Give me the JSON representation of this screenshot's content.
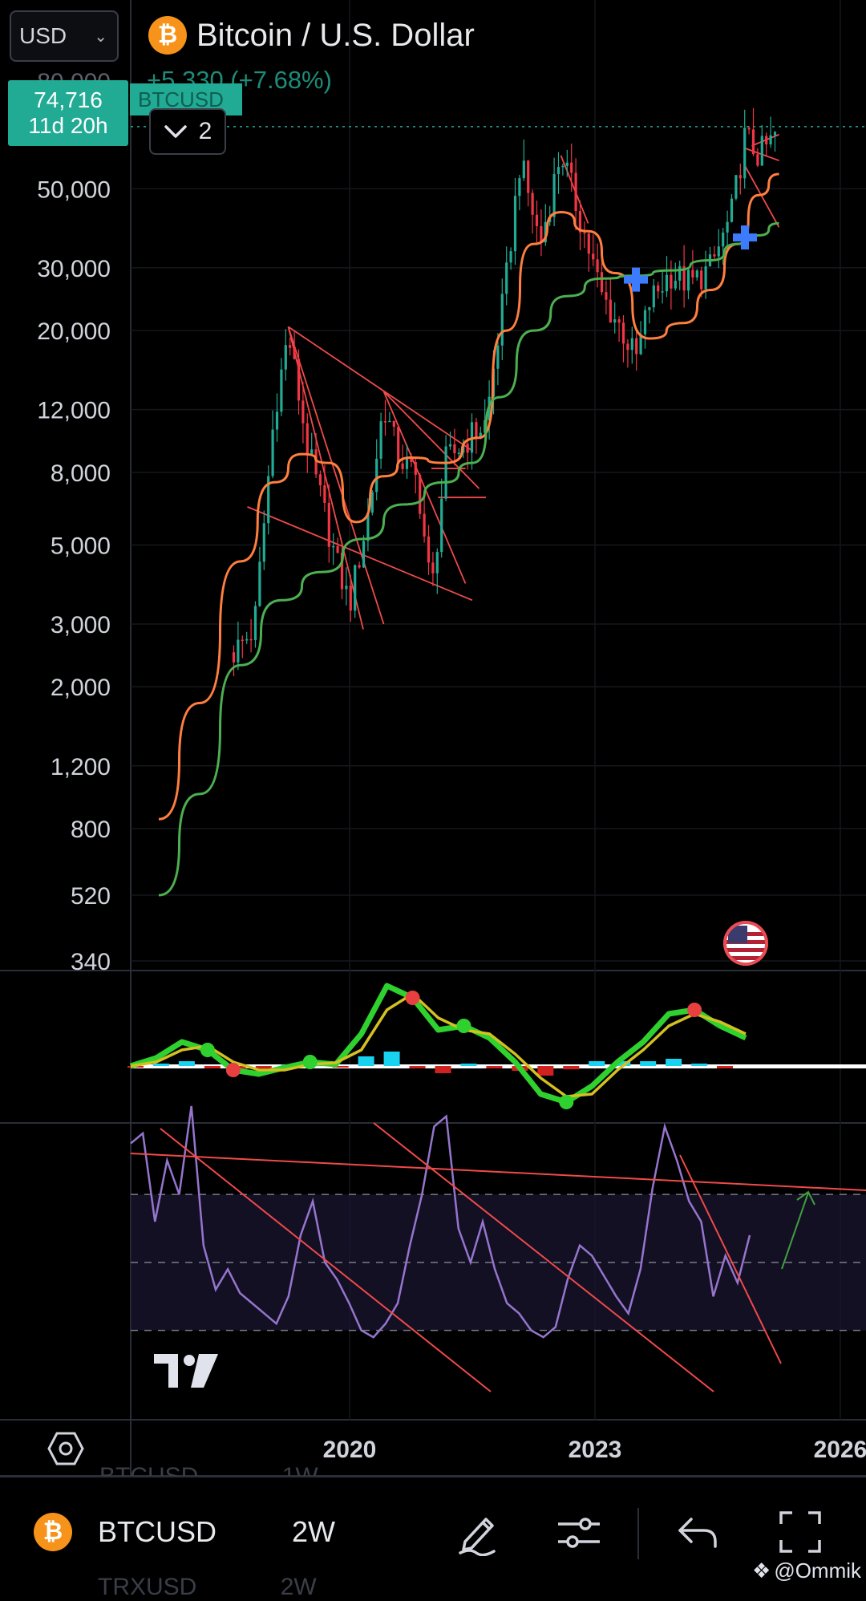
{
  "header": {
    "currency": "USD",
    "title": "Bitcoin / U.S. Dollar",
    "change": "+5,330 (+7.68%)",
    "price": "74,716",
    "countdown": "11d 20h",
    "symbol_tag": "BTCUSD",
    "collapsed_count": "2",
    "partial_top_label": "80,000"
  },
  "bottom_bar": {
    "symbol": "BTCUSD",
    "interval": "2W",
    "ghost_above_symbol": "BTCUSD",
    "ghost_above_interval": "1W",
    "ghost_below_symbol": "TRXUSD",
    "ghost_below_interval": "2W",
    "watermark": "@Ommik"
  },
  "icons": {
    "coin": "bitcoin-icon",
    "draw": "pen-icon",
    "indicators": "sliders-icon",
    "undo": "undo-icon",
    "fullscreen": "fullscreen-icon",
    "settings": "hexagon-settings-icon",
    "event": "us-flag-icon",
    "logo": "tradingview-logo-icon"
  },
  "colors": {
    "up": "#22ab94",
    "down": "#f23645",
    "ma_fast": "#ff7f3f",
    "ma_slow": "#4caf50",
    "trendline": "#f04a4a",
    "rsi": "#9575cd",
    "background": "#000000"
  },
  "chart_data": [
    {
      "type": "candlestick",
      "title": "Bitcoin / U.S. Dollar",
      "scale": "log",
      "y_ticks": [
        340,
        520,
        800,
        1200,
        2000,
        3000,
        5000,
        8000,
        12000,
        20000,
        30000,
        50000
      ],
      "x_ticks": [
        "2020",
        "2023",
        "2026"
      ],
      "last_price": 74716,
      "anchors": [
        {
          "date": "2018-08",
          "price": 2500
        },
        {
          "date": "2018-11",
          "price": 2900
        },
        {
          "date": "2019-02",
          "price": 12000
        },
        {
          "date": "2019-04",
          "price": 19500
        },
        {
          "date": "2019-07",
          "price": 9000
        },
        {
          "date": "2019-09",
          "price": 6500
        },
        {
          "date": "2019-11",
          "price": 4500
        },
        {
          "date": "2020-01",
          "price": 3400
        },
        {
          "date": "2020-04",
          "price": 6500
        },
        {
          "date": "2020-06",
          "price": 12500
        },
        {
          "date": "2020-08",
          "price": 9000
        },
        {
          "date": "2020-11",
          "price": 7500
        },
        {
          "date": "2021-01",
          "price": 3600
        },
        {
          "date": "2021-03",
          "price": 8500
        },
        {
          "date": "2021-06",
          "price": 9800
        },
        {
          "date": "2021-09",
          "price": 11000
        },
        {
          "date": "2021-12",
          "price": 28000
        },
        {
          "date": "2022-02",
          "price": 60000
        },
        {
          "date": "2022-05",
          "price": 35000
        },
        {
          "date": "2022-08",
          "price": 64000
        },
        {
          "date": "2022-11",
          "price": 40000
        },
        {
          "date": "2023-02",
          "price": 25000
        },
        {
          "date": "2023-05",
          "price": 20000
        },
        {
          "date": "2023-07",
          "price": 16500
        },
        {
          "date": "2023-09",
          "price": 24000
        },
        {
          "date": "2023-12",
          "price": 29000
        },
        {
          "date": "2024-03",
          "price": 27000
        },
        {
          "date": "2024-06",
          "price": 30000
        },
        {
          "date": "2024-09",
          "price": 42000
        },
        {
          "date": "2024-11",
          "price": 70000
        },
        {
          "date": "2025-01",
          "price": 62000
        },
        {
          "date": "2025-03",
          "price": 68000
        },
        {
          "date": "2025-04",
          "price": 74716
        }
      ],
      "moving_averages": [
        {
          "color": "#ff7f3f",
          "points": [
            [
              "2017-09",
              850
            ],
            [
              "2018-03",
              1800
            ],
            [
              "2018-09",
              4500
            ],
            [
              "2019-02",
              7500
            ],
            [
              "2019-06",
              9000
            ],
            [
              "2019-10",
              8500
            ],
            [
              "2020-02",
              5800
            ],
            [
              "2020-06",
              7800
            ],
            [
              "2020-10",
              8800
            ],
            [
              "2021-03",
              8500
            ],
            [
              "2021-08",
              10000
            ],
            [
              "2021-12",
              20000
            ],
            [
              "2022-04",
              35000
            ],
            [
              "2022-08",
              43000
            ],
            [
              "2022-12",
              38000
            ],
            [
              "2023-04",
              29000
            ],
            [
              "2023-09",
              19000
            ],
            [
              "2024-02",
              21000
            ],
            [
              "2024-06",
              26000
            ],
            [
              "2024-10",
              35000
            ],
            [
              "2025-01",
              48000
            ],
            [
              "2025-04",
              55000
            ]
          ]
        },
        {
          "color": "#4caf50",
          "points": [
            [
              "2017-09",
              520
            ],
            [
              "2018-03",
              1000
            ],
            [
              "2018-09",
              2300
            ],
            [
              "2019-03",
              3500
            ],
            [
              "2019-09",
              4200
            ],
            [
              "2020-03",
              5200
            ],
            [
              "2020-09",
              6500
            ],
            [
              "2021-03",
              7500
            ],
            [
              "2021-07",
              8500
            ],
            [
              "2021-11",
              13000
            ],
            [
              "2022-04",
              20000
            ],
            [
              "2022-09",
              25000
            ],
            [
              "2023-02",
              28000
            ],
            [
              "2023-07",
              28500
            ],
            [
              "2023-12",
              29500
            ],
            [
              "2024-06",
              31500
            ],
            [
              "2024-10",
              35000
            ],
            [
              "2025-01",
              37000
            ],
            [
              "2025-04",
              40000
            ]
          ]
        }
      ],
      "markers": [
        {
          "date": "2023-07",
          "price": 27800,
          "label": "+"
        },
        {
          "date": "2024-11",
          "price": 36500,
          "label": "+"
        }
      ],
      "event": {
        "date": "2025-04",
        "label": "us-flag"
      }
    },
    {
      "type": "oscillator",
      "series": [
        {
          "color": "#2fd12f",
          "values": [
            0,
            0.1,
            0.3,
            0.2,
            -0.05,
            -0.1,
            -0.02,
            0.05,
            0.02,
            0.4,
            1.0,
            0.85,
            0.45,
            0.5,
            0.35,
            0.05,
            -0.35,
            -0.45,
            -0.25,
            0.05,
            0.3,
            0.65,
            0.7,
            0.5,
            0.35
          ]
        },
        {
          "color": "#d4c020",
          "values": [
            0,
            0.05,
            0.2,
            0.25,
            0.05,
            -0.05,
            -0.05,
            0.02,
            0.04,
            0.2,
            0.7,
            0.9,
            0.6,
            0.45,
            0.4,
            0.15,
            -0.15,
            -0.38,
            -0.35,
            -0.05,
            0.2,
            0.5,
            0.65,
            0.55,
            0.4
          ]
        }
      ]
    },
    {
      "type": "line",
      "series": [
        {
          "color": "#9575cd",
          "values": [
            85,
            88,
            62,
            80,
            70,
            96,
            55,
            42,
            48,
            41,
            38,
            35,
            32,
            40,
            58,
            68,
            50,
            45,
            38,
            30,
            28,
            32,
            38,
            55,
            70,
            90,
            93,
            60,
            50,
            62,
            48,
            38,
            35,
            30,
            28,
            31,
            45,
            55,
            52,
            46,
            40,
            35,
            48,
            72,
            90,
            80,
            68,
            62,
            40,
            52,
            44,
            58
          ]
        }
      ],
      "bands": [
        70,
        50,
        30
      ]
    }
  ]
}
